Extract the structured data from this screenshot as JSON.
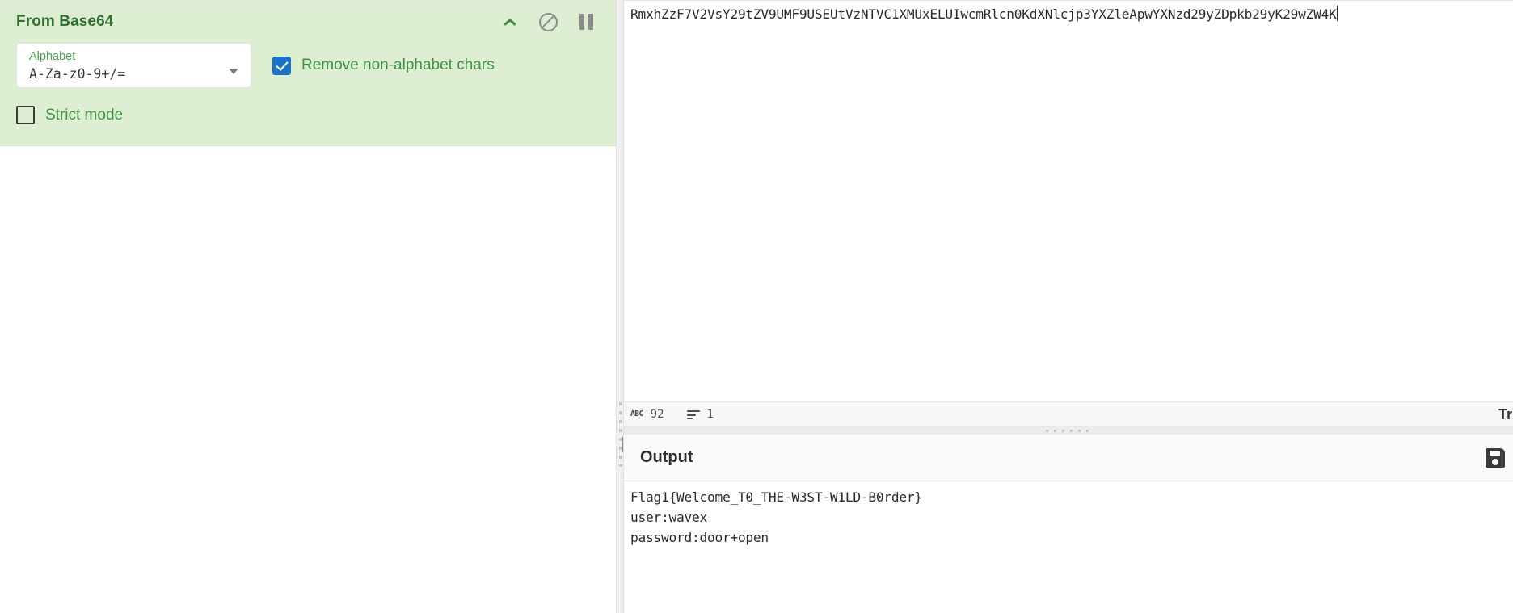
{
  "recipe": {
    "operation": {
      "title": "From Base64",
      "icons": [
        {
          "name": "collapse-chevron-up-icon",
          "label": "Collapse operation"
        },
        {
          "name": "disable-operation-icon",
          "label": "Disable operation"
        },
        {
          "name": "pause-breakpoint-icon",
          "label": "Set breakpoint"
        }
      ],
      "args": {
        "alphabet": {
          "label": "Alphabet",
          "value": "A-Za-z0-9+/=",
          "caret": "chevron-down-icon"
        },
        "remove_non_alphabet": {
          "label": "Remove non-alphabet chars",
          "checked": true
        },
        "strict_mode": {
          "label": "Strict mode",
          "checked": false
        }
      }
    }
  },
  "input": {
    "value": "RmxhZzF7V2VsY29tZV9UMF9USEUtVzNTVC1XMUxELUIwcmRlcn0KdXNlcjp3YXZleApwYXNzd29yZDpkb29yK29wZW4K",
    "status": {
      "length_icon": "ABC",
      "length": "92",
      "lines_icon": "lines-icon",
      "lines": "1",
      "right_label": "Tr"
    }
  },
  "output": {
    "title": "Output",
    "save_icon": "save-floppy-icon",
    "text": "Flag1{Welcome_T0_THE-W3ST-W1LD-B0rder}\nuser:wavex\npassword:door+open"
  },
  "colors": {
    "operation_bg": "#ddeed3",
    "operation_title": "#2e7031",
    "checkbox_accent": "#1a72c4",
    "label_green": "#3d9342"
  }
}
